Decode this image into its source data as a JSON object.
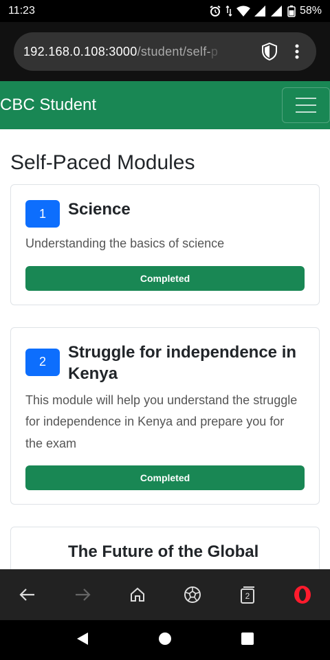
{
  "status_bar": {
    "time": "11:23",
    "battery": "58%"
  },
  "browser": {
    "url_main": "192.168.0.108:3000",
    "url_path": "/student/self-",
    "url_path_fade": "p"
  },
  "navbar": {
    "brand": "CBC Student"
  },
  "page": {
    "title": "Self-Paced Modules"
  },
  "modules": [
    {
      "number": "1",
      "title": "Science",
      "description": "Understanding the basics of science",
      "status": "Completed"
    },
    {
      "number": "2",
      "title": "Struggle for independence in Kenya",
      "description": "This module will help you understand the struggle for independence in Kenya and prepare you for the exam",
      "status": "Completed"
    },
    {
      "number": "",
      "title": "The Future of the Global",
      "description": "",
      "status": ""
    }
  ],
  "bottom_nav": {
    "tabs_count": "2"
  },
  "colors": {
    "brand_green": "#198754",
    "badge_blue": "#0d6efd"
  }
}
